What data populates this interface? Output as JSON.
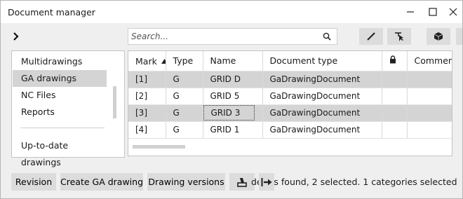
{
  "window": {
    "title": "Document manager",
    "controls": [
      "minimize",
      "maximize",
      "close"
    ]
  },
  "toolbar": {
    "search_placeholder": "Search...",
    "icons": [
      "edit-icon",
      "select-cursor-icon",
      "cube-icon"
    ]
  },
  "sidebar": {
    "items": [
      {
        "label": "Multidrawings"
      },
      {
        "label": "GA drawings",
        "selected": true
      },
      {
        "label": "NC Files"
      },
      {
        "label": "Reports"
      }
    ],
    "footer_item": "Up-to-date drawings"
  },
  "table": {
    "columns": [
      "Mark",
      "Type",
      "Name",
      "Document type",
      "",
      "Comment"
    ],
    "sorted_column": "Mark",
    "rows": [
      {
        "mark": "[1]",
        "type": "G",
        "name": "GRID D",
        "doctype": "GaDrawingDocument",
        "lock": "",
        "comment": "",
        "selected": true
      },
      {
        "mark": "[2]",
        "type": "G",
        "name": "GRID 5",
        "doctype": "GaDrawingDocument",
        "lock": "",
        "comment": "",
        "selected": false
      },
      {
        "mark": "[3]",
        "type": "G",
        "name": "GRID 3",
        "doctype": "GaDrawingDocument",
        "lock": "",
        "comment": "",
        "selected": true
      },
      {
        "mark": "[4]",
        "type": "G",
        "name": "GRID 1",
        "doctype": "GaDrawingDocument",
        "lock": "",
        "comment": "",
        "selected": false
      }
    ]
  },
  "footer": {
    "revision_label": "Revision",
    "create_label": "Create GA drawing",
    "versions_label": "Drawing versions",
    "status_text": "de    nts found, 2 selected. 1 categories selected"
  },
  "colors": {
    "selection": "#d4d4d4",
    "button": "#dcdcdc",
    "background": "#efefef"
  }
}
